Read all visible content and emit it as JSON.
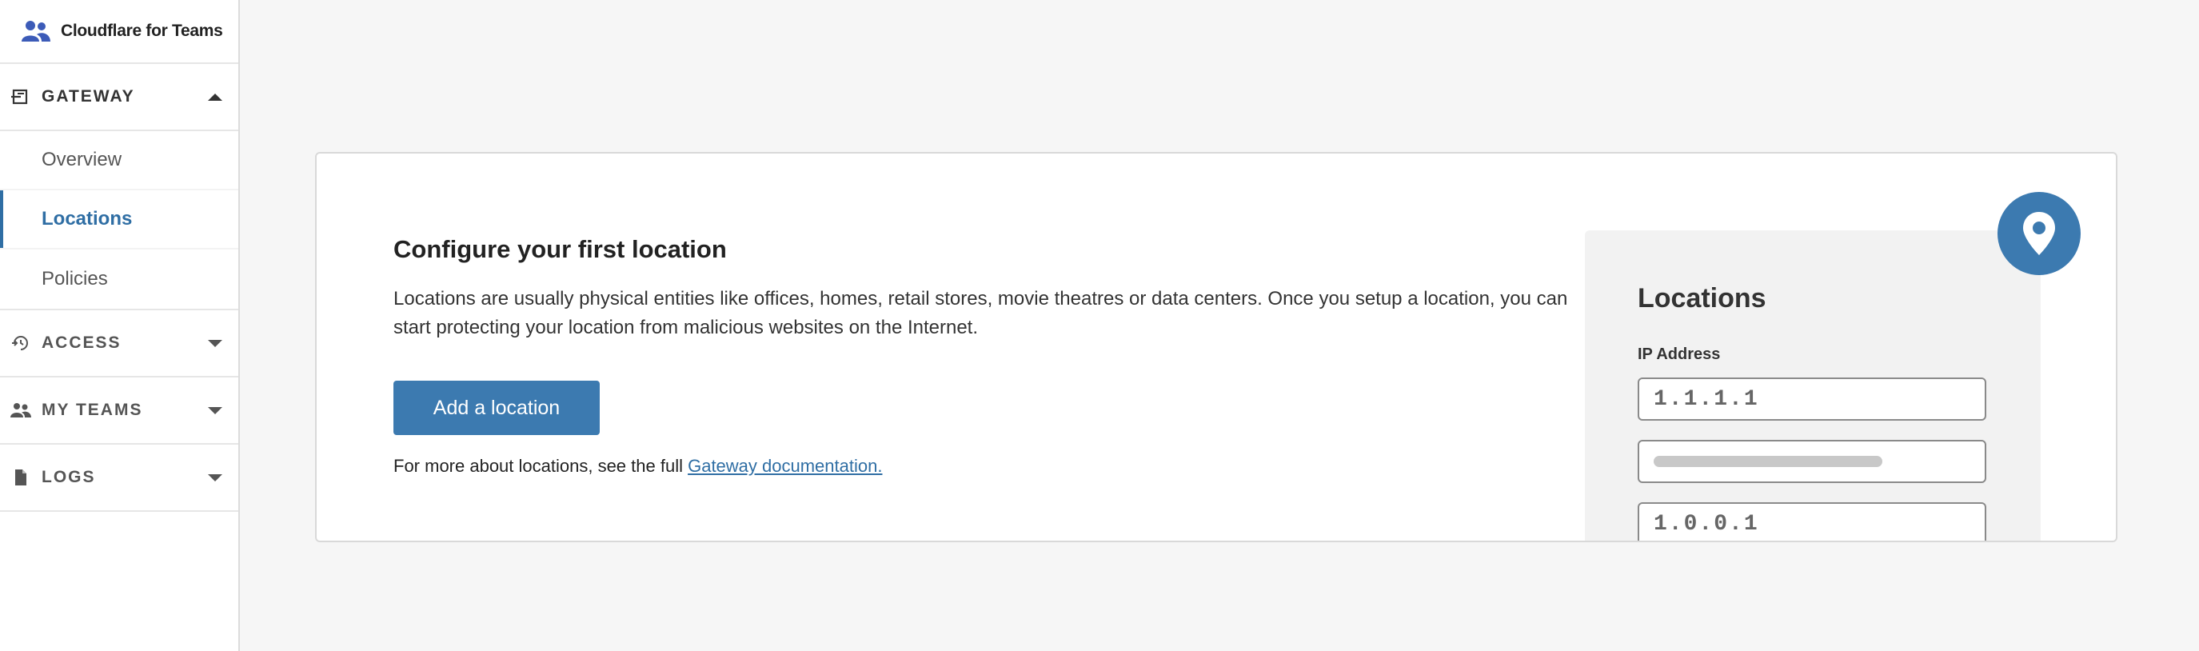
{
  "brand": {
    "name": "Cloudflare for Teams",
    "icon": "users-icon"
  },
  "sidebar": {
    "gateway": {
      "label": "GATEWAY",
      "icon": "gateway-icon",
      "expanded": true,
      "items": [
        {
          "label": "Overview",
          "active": false
        },
        {
          "label": "Locations",
          "active": true
        },
        {
          "label": "Policies",
          "active": false
        }
      ]
    },
    "sections": [
      {
        "label": "ACCESS",
        "icon": "access-icon"
      },
      {
        "label": "MY TEAMS",
        "icon": "team-icon"
      },
      {
        "label": "LOGS",
        "icon": "document-icon"
      }
    ]
  },
  "main": {
    "title": "Configure your first location",
    "description": "Locations are usually physical entities like offices, homes, retail stores, movie theatres or data centers. Once you setup a location, you can start protecting your location from malicious websites on the Internet.",
    "add_button": "Add a location",
    "more_text": "For more about locations, see the full",
    "more_link": "Gateway documentation."
  },
  "illustration": {
    "title": "Locations",
    "ip_label": "IP Address",
    "ip1": "1.1.1.1",
    "ip3": "1.0.0.1",
    "pin_icon": "location-pin-icon"
  },
  "colors": {
    "accent": "#3c7ab0",
    "active_nav": "#2f6ea4",
    "background": "#f6f6f6"
  }
}
